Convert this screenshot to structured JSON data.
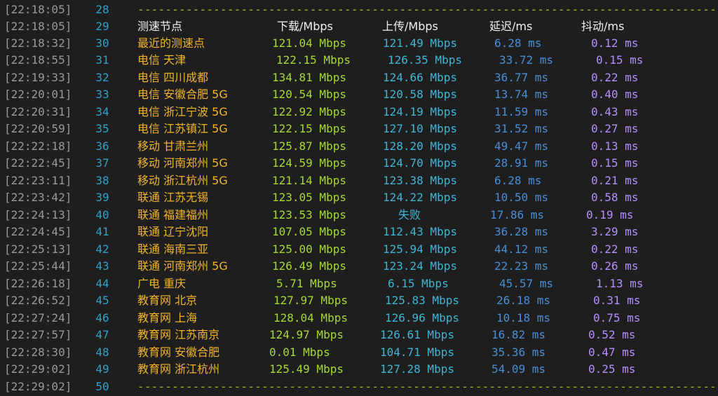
{
  "separator": "-----------------------------------------------------------------------------------------",
  "header": {
    "ts": "[22:18:05]",
    "ln": "29",
    "node": "测速节点",
    "dl": "下载/Mbps",
    "ul": "上传/Mbps",
    "lat": "延迟/ms",
    "jit": "抖动/ms"
  },
  "top_sep": {
    "ts": "[22:18:05]",
    "ln": "28"
  },
  "bottom_sep": {
    "ts": "[22:29:02]",
    "ln": "50"
  },
  "rows": [
    {
      "ts": "[22:18:32]",
      "ln": "30",
      "node": "最近的测速点",
      "dl": "121.04 Mbps",
      "ul": "121.49 Mbps",
      "lat": "6.28 ms",
      "jit": "0.12 ms"
    },
    {
      "ts": "[22:18:55]",
      "ln": "31",
      "node": "电信 天津",
      "dl": "122.15 Mbps",
      "ul": "126.35 Mbps",
      "lat": "33.72 ms",
      "jit": "0.15 ms"
    },
    {
      "ts": "[22:19:33]",
      "ln": "32",
      "node": "电信 四川成都",
      "dl": "134.81 Mbps",
      "ul": "124.66 Mbps",
      "lat": "36.77 ms",
      "jit": "0.22 ms"
    },
    {
      "ts": "[22:20:01]",
      "ln": "33",
      "node": "电信 安徽合肥 5G",
      "dl": "120.54 Mbps",
      "ul": "120.58 Mbps",
      "lat": "13.74 ms",
      "jit": "0.40 ms"
    },
    {
      "ts": "[22:20:31]",
      "ln": "34",
      "node": "电信 浙江宁波 5G",
      "dl": "122.92 Mbps",
      "ul": "124.19 Mbps",
      "lat": "11.59 ms",
      "jit": "0.43 ms"
    },
    {
      "ts": "[22:20:59]",
      "ln": "35",
      "node": "电信 江苏镇江 5G",
      "dl": "122.15 Mbps",
      "ul": "127.10 Mbps",
      "lat": "31.52 ms",
      "jit": "0.27 ms"
    },
    {
      "ts": "[22:22:18]",
      "ln": "36",
      "node": "移动 甘肃兰州",
      "dl": "125.87 Mbps",
      "ul": "128.20 Mbps",
      "lat": "49.47 ms",
      "jit": "0.13 ms"
    },
    {
      "ts": "[22:22:45]",
      "ln": "37",
      "node": "移动 河南郑州 5G",
      "dl": "124.59 Mbps",
      "ul": "124.70 Mbps",
      "lat": "28.91 ms",
      "jit": "0.15 ms"
    },
    {
      "ts": "[22:23:11]",
      "ln": "38",
      "node": "移动 浙江杭州 5G",
      "dl": "121.14 Mbps",
      "ul": "123.38 Mbps",
      "lat": "6.28 ms",
      "jit": "0.21 ms"
    },
    {
      "ts": "[22:23:42]",
      "ln": "39",
      "node": "联通 江苏无锡",
      "dl": "123.05 Mbps",
      "ul": "124.22 Mbps",
      "lat": "10.50 ms",
      "jit": "0.58 ms"
    },
    {
      "ts": "[22:24:13]",
      "ln": "40",
      "node": "联通 福建福州",
      "dl": "123.53 Mbps",
      "ul": "失败",
      "lat": "17.86 ms",
      "jit": "0.19 ms"
    },
    {
      "ts": "[22:24:45]",
      "ln": "41",
      "node": "联通 辽宁沈阳",
      "dl": "107.05 Mbps",
      "ul": "112.43 Mbps",
      "lat": "36.28 ms",
      "jit": "3.29 ms"
    },
    {
      "ts": "[22:25:13]",
      "ln": "42",
      "node": "联通 海南三亚",
      "dl": "125.00 Mbps",
      "ul": "125.94 Mbps",
      "lat": "44.12 ms",
      "jit": "0.22 ms"
    },
    {
      "ts": "[22:25:44]",
      "ln": "43",
      "node": "联通 河南郑州 5G",
      "dl": "126.49 Mbps",
      "ul": "123.24 Mbps",
      "lat": "22.23 ms",
      "jit": "0.26 ms"
    },
    {
      "ts": "[22:26:18]",
      "ln": "44",
      "node": "广电 重庆",
      "dl": "5.71 Mbps",
      "ul": "6.15 Mbps",
      "lat": "45.57 ms",
      "jit": "1.13 ms"
    },
    {
      "ts": "[22:26:52]",
      "ln": "45",
      "node": "教育网 北京",
      "dl": "127.97 Mbps",
      "ul": "125.83 Mbps",
      "lat": "26.18 ms",
      "jit": "0.31 ms"
    },
    {
      "ts": "[22:27:24]",
      "ln": "46",
      "node": "教育网 上海",
      "dl": "128.04 Mbps",
      "ul": "126.96 Mbps",
      "lat": "10.18 ms",
      "jit": "0.75 ms"
    },
    {
      "ts": "[22:27:57]",
      "ln": "47",
      "node": "教育网 江苏南京",
      "dl": "124.97 Mbps",
      "ul": "126.61 Mbps",
      "lat": "16.82 ms",
      "jit": "0.52 ms"
    },
    {
      "ts": "[22:28:30]",
      "ln": "48",
      "node": "教育网 安徽合肥",
      "dl": "0.01 Mbps",
      "ul": "104.71 Mbps",
      "lat": "35.36 ms",
      "jit": "0.47 ms"
    },
    {
      "ts": "[22:29:02]",
      "ln": "49",
      "node": "教育网 浙江杭州",
      "dl": "125.49 Mbps",
      "ul": "127.28 Mbps",
      "lat": "54.09 ms",
      "jit": "0.25 ms"
    }
  ]
}
